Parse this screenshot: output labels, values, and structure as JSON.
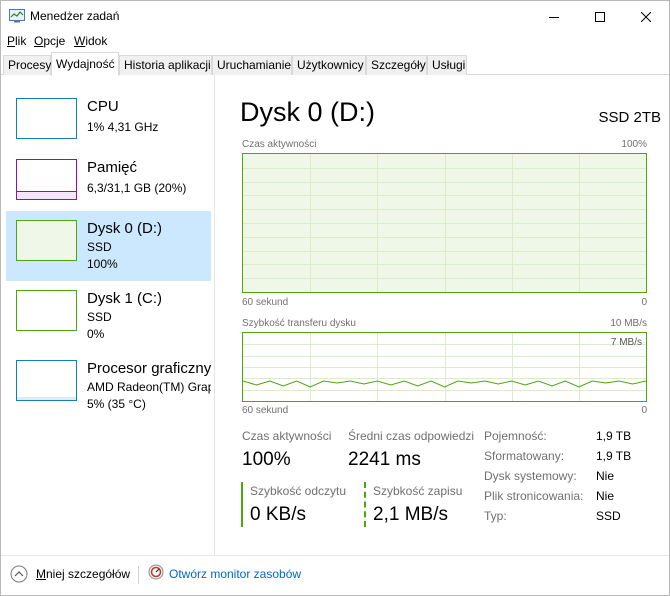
{
  "window": {
    "title": "Menedżer zadań"
  },
  "menu": [
    "Plik",
    "Opcje",
    "Widok"
  ],
  "tabs": [
    "Procesy",
    "Wydajność",
    "Historia aplikacji",
    "Uruchamianie",
    "Użytkownicy",
    "Szczegóły",
    "Usługi"
  ],
  "active_tab": "Wydajność",
  "sidebar": {
    "items": [
      {
        "title": "CPU",
        "line1": "1%  4,31 GHz",
        "line2": ""
      },
      {
        "title": "Pamięć",
        "line1": "6,3/31,1 GB (20%)",
        "line2": ""
      },
      {
        "title": "Dysk 0 (D:)",
        "line1": "SSD",
        "line2": "100%"
      },
      {
        "title": "Dysk 1 (C:)",
        "line1": "SSD",
        "line2": "0%"
      },
      {
        "title": "Procesor graficzny",
        "line1": "AMD Radeon(TM) Graph",
        "line2": "5% (35 °C)"
      }
    ]
  },
  "main": {
    "title": "Dysk 0 (D:)",
    "model": "SSD 2TB",
    "activity_graph": {
      "label": "Czas aktywności",
      "max": "100%",
      "x_left": "60 sekund",
      "x_right": "0",
      "level_percent": 100
    },
    "transfer_graph": {
      "label": "Szybkość transferu dysku",
      "max": "10 MB/s",
      "inner_max": "7 MB/s",
      "x_left": "60 sekund",
      "x_right": "0"
    },
    "stats": {
      "active_time_label": "Czas aktywności",
      "active_time_value": "100%",
      "response_label": "Średni czas odpowiedzi",
      "response_value": "2241 ms",
      "read_label": "Szybkość odczytu",
      "read_value": "0 KB/s",
      "write_label": "Szybkość zapisu",
      "write_value": "2,1 MB/s"
    },
    "properties": [
      {
        "label": "Pojemność:",
        "value": "1,9 TB"
      },
      {
        "label": "Sformatowany:",
        "value": "1,9 TB"
      },
      {
        "label": "Dysk systemowy:",
        "value": "Nie"
      },
      {
        "label": "Plik stronicowania:",
        "value": "Nie"
      },
      {
        "label": "Typ:",
        "value": "SSD"
      }
    ]
  },
  "footer": {
    "fewer_details": "Mniej szczegółów",
    "open_monitor": "Otwórz monitor zasobów"
  },
  "colors": {
    "disk_green": "#4da60c",
    "cpu_blue": "#117dbb",
    "memory_purple": "#8b12ae",
    "selection": "#cce8ff"
  }
}
